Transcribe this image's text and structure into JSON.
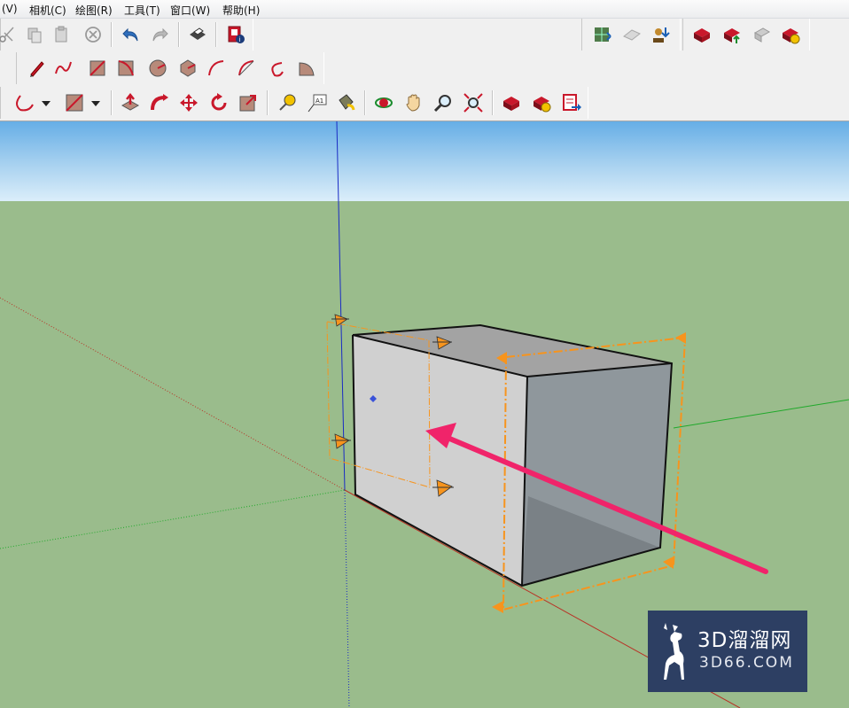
{
  "menu": {
    "items": [
      "(V)",
      "相机(C)",
      "绘图(R)",
      "工具(T)",
      "窗口(W)",
      "帮助(H)"
    ]
  },
  "toolbar": {
    "row1_tools": [
      "scissors-icon",
      "copy-icon",
      "paste-icon",
      "erase-icon",
      "undo-icon",
      "redo-icon",
      "print-icon",
      "model-info-icon"
    ],
    "row1_right_tools": [
      "get-models-icon",
      "share-model-icon",
      "add-location-icon",
      "components-icon",
      "share-component-icon",
      "extension-warehouse-icon",
      "extension-manager-icon"
    ],
    "row2_tools": [
      "pencil-icon",
      "freehand-icon",
      "rectangle-icon",
      "rotated-rectangle-icon",
      "circle-icon",
      "polygon-icon",
      "arc-icon",
      "two-point-arc-icon",
      "three-point-arc-icon",
      "pie-icon"
    ],
    "row3_tools": [
      "arc-dropdown-icon",
      "shape-dropdown-icon",
      "push-pull-icon",
      "follow-me-icon",
      "move-icon",
      "rotate-icon",
      "offset-icon",
      "tape-measure-icon",
      "text-icon",
      "paint-bucket-icon",
      "orbit-icon",
      "pan-icon",
      "zoom-icon",
      "zoom-extents-icon",
      "warehouse-icon",
      "component-warehouse-icon",
      "send-to-layout-icon"
    ]
  },
  "colors": {
    "sky_top": "#66aee6",
    "ground": "#9abc8c",
    "box_front": "#d0d0d0",
    "box_top": "#a3a3a3",
    "box_right": "#8f979c",
    "selection": "#f7941d",
    "annotation_arrow": "#f0246a",
    "logo_bg": "#2d3f63"
  },
  "logo": {
    "title": "3D溜溜网",
    "subtitle": "3D66.COM"
  }
}
